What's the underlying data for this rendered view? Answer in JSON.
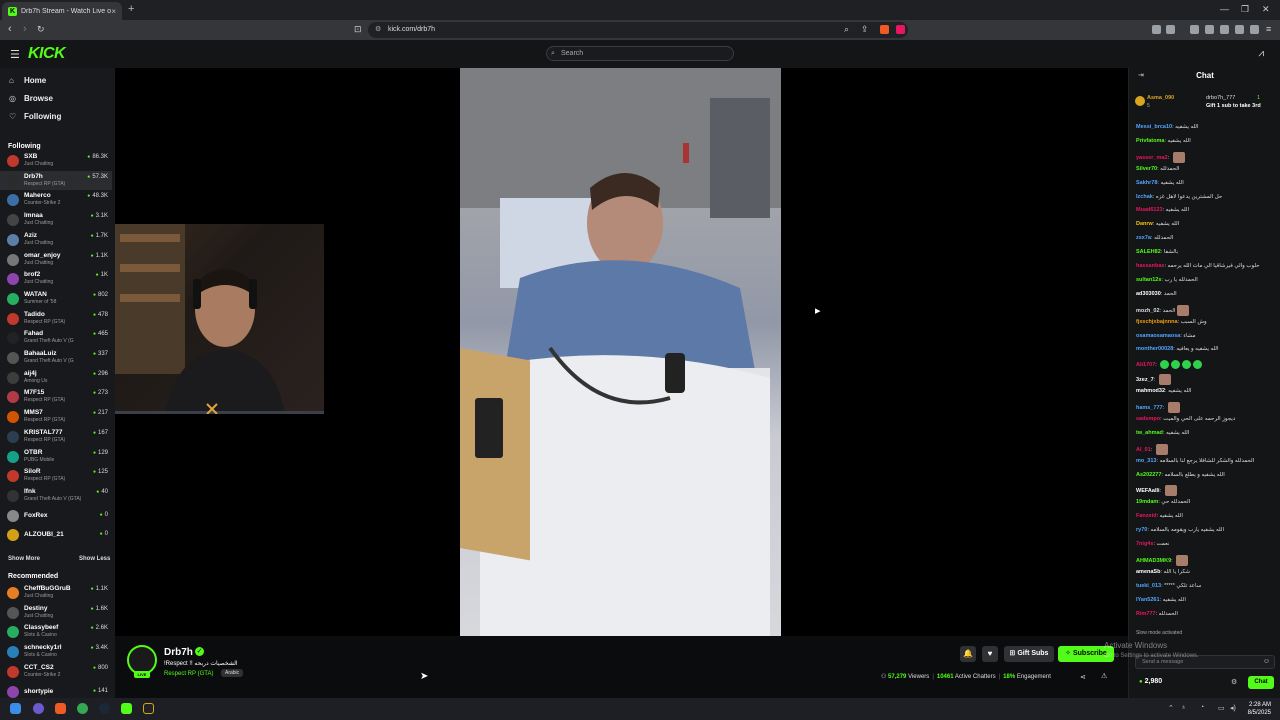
{
  "browser": {
    "tab_title": "Drb7h Stream - Watch Live o",
    "url": "kick.com/drb7h",
    "new_tab": "+",
    "close": "×"
  },
  "header": {
    "logo": "KICK",
    "search_placeholder": "Search"
  },
  "sidebar": {
    "nav": [
      {
        "label": "Home",
        "icon": "home-icon"
      },
      {
        "label": "Browse",
        "icon": "browse-icon"
      },
      {
        "label": "Following",
        "icon": "heart-icon"
      }
    ],
    "following_title": "Following",
    "following": [
      {
        "name": "SXB",
        "category": "Just Chatting",
        "viewers": "86.3K",
        "color": "#c0392b"
      },
      {
        "name": "Drb7h",
        "category": "Respect RP (GTA)",
        "viewers": "57.3K",
        "color": "#2b2b2b"
      },
      {
        "name": "Maherco",
        "category": "Counter-Strike 2",
        "viewers": "48.3K",
        "color": "#3b6ea5"
      },
      {
        "name": "Imnaa",
        "category": "Just Chatting",
        "viewers": "3.1K",
        "color": "#444"
      },
      {
        "name": "Aziz",
        "category": "Just Chatting",
        "viewers": "1.7K",
        "color": "#5b7fa8"
      },
      {
        "name": "omar_enjoy",
        "category": "Just Chatting",
        "viewers": "1.1K",
        "color": "#777"
      },
      {
        "name": "brof2",
        "category": "Just Chatting",
        "viewers": "1K",
        "color": "#8e44ad"
      },
      {
        "name": "WATAN",
        "category": "Summer of '58",
        "viewers": "802",
        "color": "#27ae60"
      },
      {
        "name": "Tadido",
        "category": "Respect RP (GTA)",
        "viewers": "478",
        "color": "#c0392b"
      },
      {
        "name": "Fahad",
        "category": "Grand Theft Auto V (G",
        "viewers": "465",
        "color": "#222"
      },
      {
        "name": "BahaaLuiz",
        "category": "Grand Theft Auto V (G",
        "viewers": "337",
        "color": "#555"
      },
      {
        "name": "aij4j",
        "category": "Among Us",
        "viewers": "296",
        "color": "#3d3d3d"
      },
      {
        "name": "M7F15",
        "category": "Respect RP (GTA)",
        "viewers": "273",
        "color": "#b23a48"
      },
      {
        "name": "MMS7",
        "category": "Respect RP (GTA)",
        "viewers": "217",
        "color": "#d35400"
      },
      {
        "name": "KRISTAL777",
        "category": "Respect RP (GTA)",
        "viewers": "167",
        "color": "#2c3e50"
      },
      {
        "name": "OTBR",
        "category": "PUBG Mobile",
        "viewers": "129",
        "color": "#16a085"
      },
      {
        "name": "SiloR",
        "category": "Respect RP (GTA)",
        "viewers": "125",
        "color": "#c0392b"
      },
      {
        "name": "lfnk",
        "category": "Grand Theft Auto V (GTA)",
        "viewers": "40",
        "color": "#333"
      },
      {
        "name": "FoxRex",
        "category": "",
        "viewers": "0",
        "color": "#888"
      },
      {
        "name": "ALZOUBI_21",
        "category": "",
        "viewers": "0",
        "color": "#d4a017"
      }
    ],
    "show_more": "Show More",
    "show_less": "Show Less",
    "recommended_title": "Recommended",
    "recommended": [
      {
        "name": "CheffBuGGruB",
        "category": "Just Chatting",
        "viewers": "1.1K",
        "color": "#e67e22"
      },
      {
        "name": "Destiny",
        "category": "Just Chatting",
        "viewers": "1.6K",
        "color": "#555"
      },
      {
        "name": "Classybeef",
        "category": "Slots & Casino",
        "viewers": "2.6K",
        "color": "#27ae60"
      },
      {
        "name": "schnecky1rl",
        "category": "Slots & Casino",
        "viewers": "3.4K",
        "color": "#2980b9"
      },
      {
        "name": "CCT_CS2",
        "category": "Counter-Strike 2",
        "viewers": "800",
        "color": "#c0392b"
      },
      {
        "name": "shortypie",
        "category": "",
        "viewers": "141",
        "color": "#8e44ad"
      }
    ]
  },
  "stream": {
    "streamer": "Drb7h",
    "title": "!Respect !! الشخصيات دربحه",
    "category": "Respect RP (GTA)",
    "language": "Arabic",
    "live_badge": "LIVE",
    "gift_subs": "Gift Subs",
    "subscribe": "Subscribe",
    "viewers": "57,279",
    "viewers_label": "Viewers",
    "chatters": "10461",
    "chatters_label": "Active Chatters",
    "engagement": "18%",
    "engagement_label": "Engagement"
  },
  "chat": {
    "title": "Chat",
    "pinned": {
      "user": "Asma_090",
      "count": "5",
      "gifter": "drbo7h_777",
      "gift_text": "Gift 1 sub to take 3rd",
      "gift_count": "1"
    },
    "messages": [
      {
        "user": "Messi_brca10",
        "text": "الله يشفيه",
        "color": "#53a6ff",
        "emotes": 0
      },
      {
        "user": "Privfatoma",
        "text": "الله يشفيه",
        "color": "#53fc18",
        "emotes": 0
      },
      {
        "user": "yasser_ma2",
        "text": "",
        "color": "#e8175d",
        "emotes": 1
      },
      {
        "user": "Silver70",
        "text": "الحمدلله",
        "color": "#53fc18",
        "emotes": 0
      },
      {
        "user": "Sakhr78",
        "text": "الله يشفيه",
        "color": "#53a6ff",
        "emotes": 0
      },
      {
        "user": "Izchak",
        "text": "حل المشترين يدعوا لاهل غزه",
        "color": "#53a6ff",
        "emotes": 0
      },
      {
        "user": "Muad6123",
        "text": "الله يشفيه",
        "color": "#e8175d",
        "emotes": 0
      },
      {
        "user": "Danrw",
        "text": "الله يشفيه",
        "color": "#f1c40f",
        "emotes": 0
      },
      {
        "user": "zsx7a",
        "text": "الحمدلله",
        "color": "#53a6ff",
        "emotes": 0
      },
      {
        "user": "SALEH82",
        "text": "بالشفا",
        "color": "#53fc18",
        "emotes": 0
      },
      {
        "user": "hassanbas",
        "text": "حلوب والي فيرشاقيا الي مات الله يرحمه",
        "color": "#e8175d",
        "emotes": 0
      },
      {
        "user": "sultan12s",
        "text": "الحمدلله يا رب",
        "color": "#53fc18",
        "emotes": 0
      },
      {
        "user": "ad303030",
        "text": "الحمد",
        "color": "#fff",
        "emotes": 0
      },
      {
        "user": "mozh_02",
        "text": "الحمد",
        "color": "#ddd",
        "emotes": 1
      },
      {
        "user": "fjxschjxbajnnna",
        "text": "وش السبب",
        "color": "#f39c12",
        "emotes": 0
      },
      {
        "user": "osamaosamaosa",
        "text": "مشاء",
        "color": "#53a6ff",
        "emotes": 0
      },
      {
        "user": "monther00028",
        "text": "الله يشفيه و يعافيه",
        "color": "#53a6ff",
        "emotes": 0
      },
      {
        "user": "Ali1707",
        "text": "",
        "color": "#e8175d",
        "emotes": 4
      },
      {
        "user": "3zez_7",
        "text": "",
        "color": "#fff",
        "emotes": 1
      },
      {
        "user": "mahmod32",
        "text": "الله يشفيه",
        "color": "#fff",
        "emotes": 0
      },
      {
        "user": "hams_777",
        "text": "",
        "color": "#53a6ff",
        "emotes": 1
      },
      {
        "user": "sadsmpo",
        "text": "ديجوز الرحمه على الحي والميت",
        "color": "#e8175d",
        "emotes": 0
      },
      {
        "user": "tw_ahmad",
        "text": "الله يشفيه",
        "color": "#53fc18",
        "emotes": 0
      },
      {
        "user": "Al_01",
        "text": "",
        "color": "#e8175d",
        "emotes": 1
      },
      {
        "user": "mo_313",
        "text": "الحمدلله والشكر للشافلا يرجع لنا بالسلامه",
        "color": "#53a6ff",
        "emotes": 0
      },
      {
        "user": "As202277",
        "text": "الله يشفيه و يطلع بالسلامه",
        "color": "#53fc18",
        "emotes": 0
      },
      {
        "user": "WEFAalli",
        "text": "",
        "color": "#fff",
        "emotes": 1
      },
      {
        "user": "19mdam",
        "text": "الحمدلله حي",
        "color": "#53fc18",
        "emotes": 0
      },
      {
        "user": "Fanzeid",
        "text": "الله يشفيه",
        "color": "#e8175d",
        "emotes": 0
      },
      {
        "user": "ry70",
        "text": "الله يشفيه يارب ويقومه بالسلامه",
        "color": "#53a6ff",
        "emotes": 0
      },
      {
        "user": "7nig4s",
        "text": "نعمت",
        "color": "#e8175d",
        "emotes": 0
      },
      {
        "user": "AHMAD3MK9",
        "text": "",
        "color": "#53fc18",
        "emotes": 1
      },
      {
        "user": "amenaSb",
        "text": "شكرا يا الله",
        "color": "#fff",
        "emotes": 0
      },
      {
        "user": "tueki_013",
        "text": "***** ساعد تلكي",
        "color": "#53a6ff",
        "emotes": 0
      },
      {
        "user": "IYan5261",
        "text": "الله يشفيه",
        "color": "#53a6ff",
        "emotes": 0
      },
      {
        "user": "Rim777",
        "text": "الحمدلله",
        "color": "#e8175d",
        "emotes": 0
      }
    ],
    "slow_mode": "Slow mode activated",
    "input_placeholder": "Send a message",
    "points": "2,980",
    "chat_button": "Chat"
  },
  "watermark": {
    "line1": "Activate Windows",
    "line2": "Go to Settings to activate Windows."
  },
  "taskbar": {
    "time": "2:28 AM",
    "date": "8/5/2025"
  }
}
